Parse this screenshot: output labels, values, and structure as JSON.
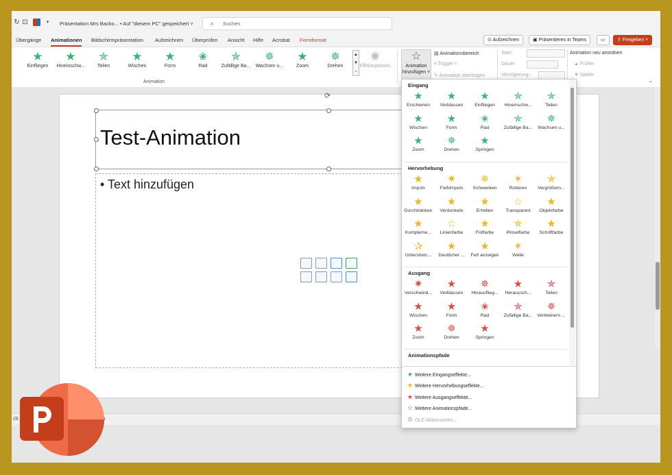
{
  "titlebar": {
    "title": "Präsentation Mrs Backo...  •  Auf \"diesem PC\" gespeichert ˅",
    "search_placeholder": "Suchen",
    "search_icon": "search-icon"
  },
  "tabs": [
    "Übergänge",
    "Animationen",
    "Bildschirmpräsentation",
    "Aufzeichnen",
    "Überprüfen",
    "Ansicht",
    "Hilfe",
    "Acrobat",
    "Formformat"
  ],
  "active_tab": "Animationen",
  "top_buttons": {
    "record": "Aufzeichnen",
    "teams": "Präsentieren in Teams",
    "share": "Freigeben ˅"
  },
  "ribbon": {
    "animations": [
      "Einfliegen",
      "Hineinschw...",
      "Teilen",
      "Wischen",
      "Form",
      "Rad",
      "Zufällige Ba...",
      "Wachsen u...",
      "Zoom",
      "Drehen"
    ],
    "effect_options": "Effektoptionen",
    "group_label": "Animation",
    "add_animation": "Animation hinzufügen ˅",
    "animation_pane": "Animationsbereich",
    "trigger": "Trigger ˅",
    "painter": "Animation übertragen",
    "start": "Start:",
    "duration": "Dauer:",
    "delay": "Verzögerung:",
    "reorder": "Animation neu anordnen",
    "earlier": "▲ Früher",
    "later": "▼ Später"
  },
  "slide": {
    "title": "Test-Animation",
    "body": "• Text hinzufügen"
  },
  "notes_text": "gen",
  "notes_left": "ck",
  "dropdown": {
    "sections": {
      "entrance": "Eingang",
      "emphasis": "Hervorhebung",
      "exit": "Ausgang",
      "paths": "Animationspfade"
    },
    "entrance": [
      "Erscheinen",
      "Verblassen",
      "Einfliegen",
      "Hineinschw...",
      "Teilen",
      "Wischen",
      "Form",
      "Rad",
      "Zufällige Ba...",
      "Wachsen u...",
      "Zoom",
      "Drehen",
      "Springen"
    ],
    "emphasis": [
      "Impuls",
      "Farbimpuls",
      "Schwanken",
      "Rotieren",
      "Vergrößern...",
      "Durchtränken",
      "Verdunkeln",
      "Erhellen",
      "Transparent",
      "Objektfarbe",
      "Kompleme...",
      "Linienfarbe",
      "Füllfarbe",
      "Pinselfarbe",
      "Schriftfarbe",
      "Unterstreic...",
      "Deutlicher ...",
      "Fett anzeigen",
      "Welle"
    ],
    "exit": [
      "Verschwind...",
      "Verblassen",
      "Hinausflieg...",
      "Heraussch...",
      "Teilen",
      "Wischen",
      "Form",
      "Rad",
      "Zufällige Ba...",
      "Verkleinern ...",
      "Zoom",
      "Drehen",
      "Springen"
    ],
    "more": [
      "Weitere Eingangseffekte...",
      "Weitere Hervorhebungseffekte...",
      "Weitere Ausgangseffekte...",
      "Weitere Animationspfade...",
      "OLE-Aktionsarten..."
    ]
  },
  "colors": {
    "accent": "#c43e1c",
    "entrance": "#3cb371",
    "emphasis": "#f0b429",
    "exit": "#e0474c",
    "frame": "#b8961f"
  }
}
